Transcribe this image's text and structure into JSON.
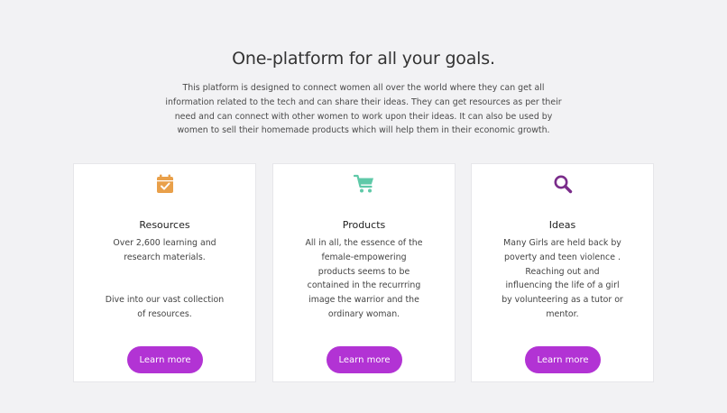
{
  "section": {
    "title": "One-platform for all your goals.",
    "description": "This platform is designed to connect women all over the world where they can get all information related to the tech and can share their ideas. They can get resources as per their need and can connect with other women to work upon their ideas. It can also be used by women to sell their homemade products which will help them in their economic growth."
  },
  "colors": {
    "background": "#f2f2f4",
    "button": "#b233d4",
    "resources_icon": "#e9a04a",
    "products_icon": "#5fc9a8",
    "ideas_icon": "#7a2c8a"
  },
  "cards": [
    {
      "icon": "calendar-check-icon",
      "title": "Resources",
      "text_lines": [
        "Over 2,600 learning and",
        "research materials."
      ],
      "text_lines_after_gap": [
        "Dive into our vast collection",
        "of resources."
      ],
      "button_label": "Learn more"
    },
    {
      "icon": "shopping-cart-icon",
      "title": "Products",
      "text_lines": [
        "All in all, the essence of the",
        "female-empowering",
        "products seems to be",
        "contained in the recurrring",
        "image the warrior and the",
        "ordinary woman."
      ],
      "button_label": "Learn more"
    },
    {
      "icon": "search-icon",
      "title": "Ideas",
      "text_lines": [
        "Many Girls are held back by",
        "poverty and teen violence .",
        "Reaching out and",
        "influencing the life of a girl",
        "by volunteering as a tutor or",
        "mentor."
      ],
      "button_label": "Learn more"
    }
  ]
}
